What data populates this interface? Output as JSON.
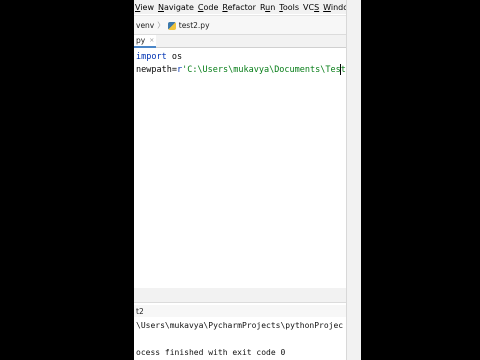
{
  "menu": {
    "items": [
      {
        "label": "View",
        "underline": "V"
      },
      {
        "label": "Navigate",
        "underline": "N"
      },
      {
        "label": "Code",
        "underline": "C"
      },
      {
        "label": "Refactor",
        "underline": "R"
      },
      {
        "label": "Run",
        "underline": "u"
      },
      {
        "label": "Tools",
        "underline": "T"
      },
      {
        "label": "VCS",
        "underline": "S"
      },
      {
        "label": "Window",
        "underline": "W"
      }
    ]
  },
  "navbar": {
    "folder": "venv",
    "separator": "〉",
    "file": "test2.py"
  },
  "editor_tab": {
    "label": "py",
    "close": "×"
  },
  "code": {
    "line1": {
      "keyword": "import",
      "module": "os"
    },
    "line2": {
      "var": "newpath",
      "op": "=",
      "prefix": "r",
      "string": "'C:\\Users\\mukavya\\Documents\\Test'"
    }
  },
  "run_panel": {
    "title": "t2"
  },
  "console": {
    "line1": "\\Users\\mukavya\\PycharmProjects\\pythonProjec",
    "line2": "ocess finished with exit code 0"
  },
  "colors": {
    "keyword": "#0033b3",
    "string": "#067d17",
    "accent": "#4a86c8"
  }
}
